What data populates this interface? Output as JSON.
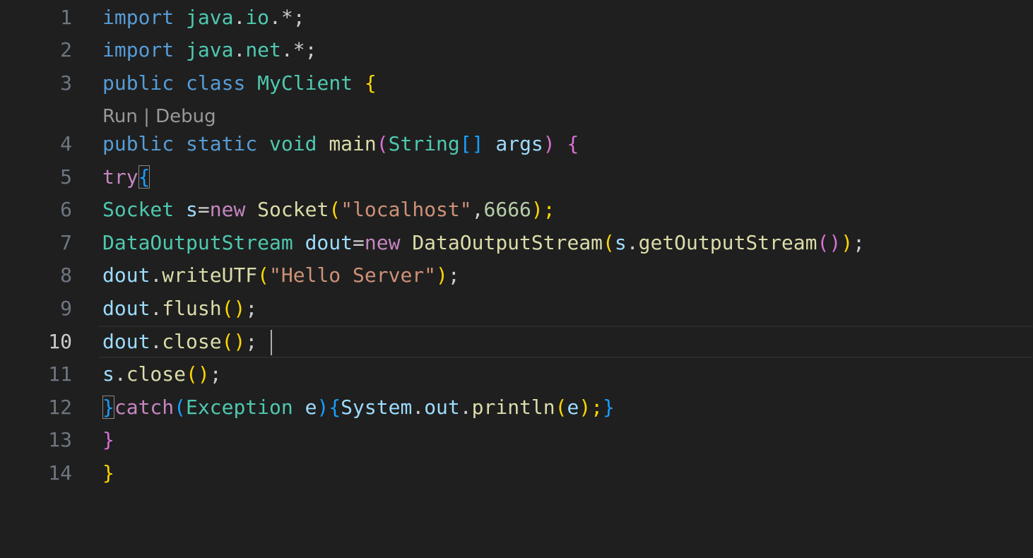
{
  "editor": {
    "codelens": {
      "run": "Run",
      "sep": " | ",
      "debug": "Debug"
    },
    "lines": [
      {
        "n": "1",
        "t": [
          "import",
          " ",
          "java",
          ".",
          "io",
          ".*;"
        ]
      },
      {
        "n": "2",
        "t": [
          "import",
          " ",
          "java",
          ".",
          "net",
          ".*;"
        ]
      },
      {
        "n": "3",
        "t": [
          "public",
          " ",
          "class",
          " ",
          "MyClient",
          " ",
          "{"
        ]
      },
      {
        "n": "4",
        "t": [
          "public",
          " ",
          "static",
          " ",
          "void",
          " ",
          "main",
          "(",
          "String",
          "[]",
          " ",
          "args",
          ")",
          " ",
          "{"
        ]
      },
      {
        "n": "5",
        "t": [
          "try",
          "{"
        ]
      },
      {
        "n": "6",
        "t": [
          "Socket",
          " ",
          "s",
          "=",
          "new",
          " ",
          "Socket",
          "(",
          "\"localhost\"",
          ",",
          "6666",
          ");"
        ]
      },
      {
        "n": "7",
        "t": [
          "DataOutputStream",
          " ",
          "dout",
          "=",
          "new",
          " ",
          "DataOutputStream",
          "(",
          "s",
          ".",
          "getOutputStream",
          "()",
          ")",
          ";"
        ]
      },
      {
        "n": "8",
        "t": [
          "dout",
          ".",
          "writeUTF",
          "(",
          "\"Hello Server\"",
          ")",
          ";"
        ]
      },
      {
        "n": "9",
        "t": [
          "dout",
          ".",
          "flush",
          "()",
          ";"
        ]
      },
      {
        "n": "10",
        "t": [
          "dout",
          ".",
          "close",
          "()",
          "; "
        ]
      },
      {
        "n": "11",
        "t": [
          "s",
          ".",
          "close",
          "()",
          ";"
        ]
      },
      {
        "n": "12",
        "t": [
          "}",
          "catch",
          "(",
          "Exception",
          " ",
          "e",
          ")",
          "{",
          "System",
          ".",
          "out",
          ".",
          "println",
          "(",
          "e",
          ");",
          "}"
        ]
      },
      {
        "n": "13",
        "t": [
          "}"
        ]
      },
      {
        "n": "14",
        "t": [
          "}"
        ]
      }
    ]
  }
}
